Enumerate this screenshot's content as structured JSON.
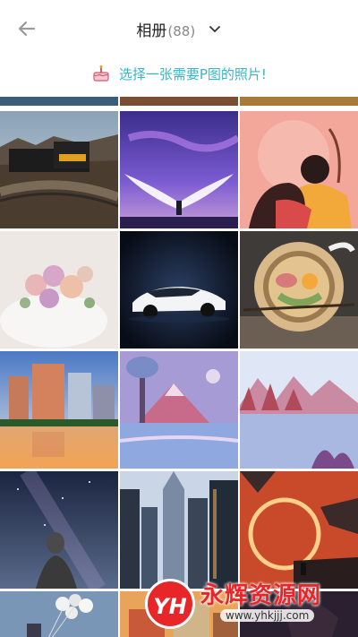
{
  "header": {
    "title": "相册",
    "count": "(88)",
    "back_icon": "arrow-left-icon",
    "dropdown_icon": "chevron-down-icon"
  },
  "tip": {
    "text": "选择一张需要P图的照片!",
    "icon": "cake-icon",
    "color": "#38b5c9"
  },
  "photos": [
    {
      "subject": "train-on-bridge"
    },
    {
      "subject": "angel-wings-figure"
    },
    {
      "subject": "illustrated-couple"
    },
    {
      "subject": "flower-cake"
    },
    {
      "subject": "white-sports-car"
    },
    {
      "subject": "noodle-bowl"
    },
    {
      "subject": "city-night-reflection"
    },
    {
      "subject": "painted-mountain-lake"
    },
    {
      "subject": "painted-forest-lake"
    },
    {
      "subject": "milky-way-statue"
    },
    {
      "subject": "skyscrapers"
    },
    {
      "subject": "red-sunset-rocks"
    },
    {
      "subject": "balloons"
    },
    {
      "subject": "street-buildings"
    },
    {
      "subject": "portrait"
    }
  ],
  "watermark": {
    "logo_text": "YH",
    "brand": "永辉资源网",
    "url": "www.yhkjjj.com"
  }
}
